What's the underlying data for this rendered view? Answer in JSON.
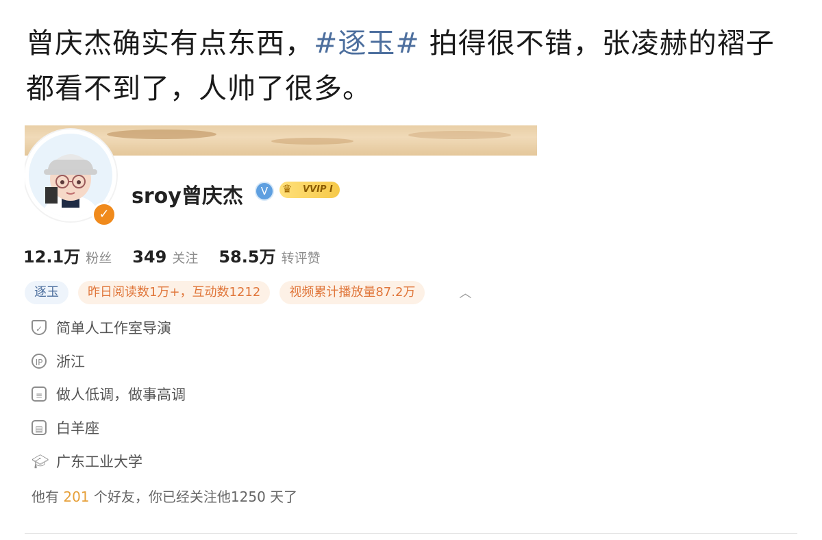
{
  "post": {
    "text_before": "曾庆杰确实有点东西，",
    "topic": "#逐玉#",
    "text_after": " 拍得很不错，张凌赫的褶子都看不到了，人帅了很多。"
  },
  "profile": {
    "username": "sroy曾庆杰",
    "verified_badge": "V",
    "vip_label": "VVIP I",
    "stats": [
      {
        "value": "12.1万",
        "label": "粉丝"
      },
      {
        "value": "349",
        "label": "关注"
      },
      {
        "value": "58.5万",
        "label": "转评赞"
      }
    ],
    "tags": [
      "逐玉",
      "昨日阅读数1万+，互动数1212",
      "视频累计播放量87.2万"
    ],
    "info": [
      {
        "icon": "shield-icon",
        "text": "简单人工作室导演"
      },
      {
        "icon": "ip-icon",
        "text": "浙江"
      },
      {
        "icon": "document-icon",
        "text": "做人低调，做事高调"
      },
      {
        "icon": "calendar-icon",
        "text": "白羊座"
      },
      {
        "icon": "graduation-cap-icon",
        "text": "广东工业大学"
      }
    ],
    "friends": {
      "prefix": "他有 ",
      "count": "201",
      "suffix": " 个好友，你已经关注他1250 天了"
    }
  },
  "colors": {
    "topic": "#4d6f9e",
    "tag_orange": "#e0763a",
    "vip_gold": "#f6c94a",
    "friend_count": "#e6a03a"
  }
}
